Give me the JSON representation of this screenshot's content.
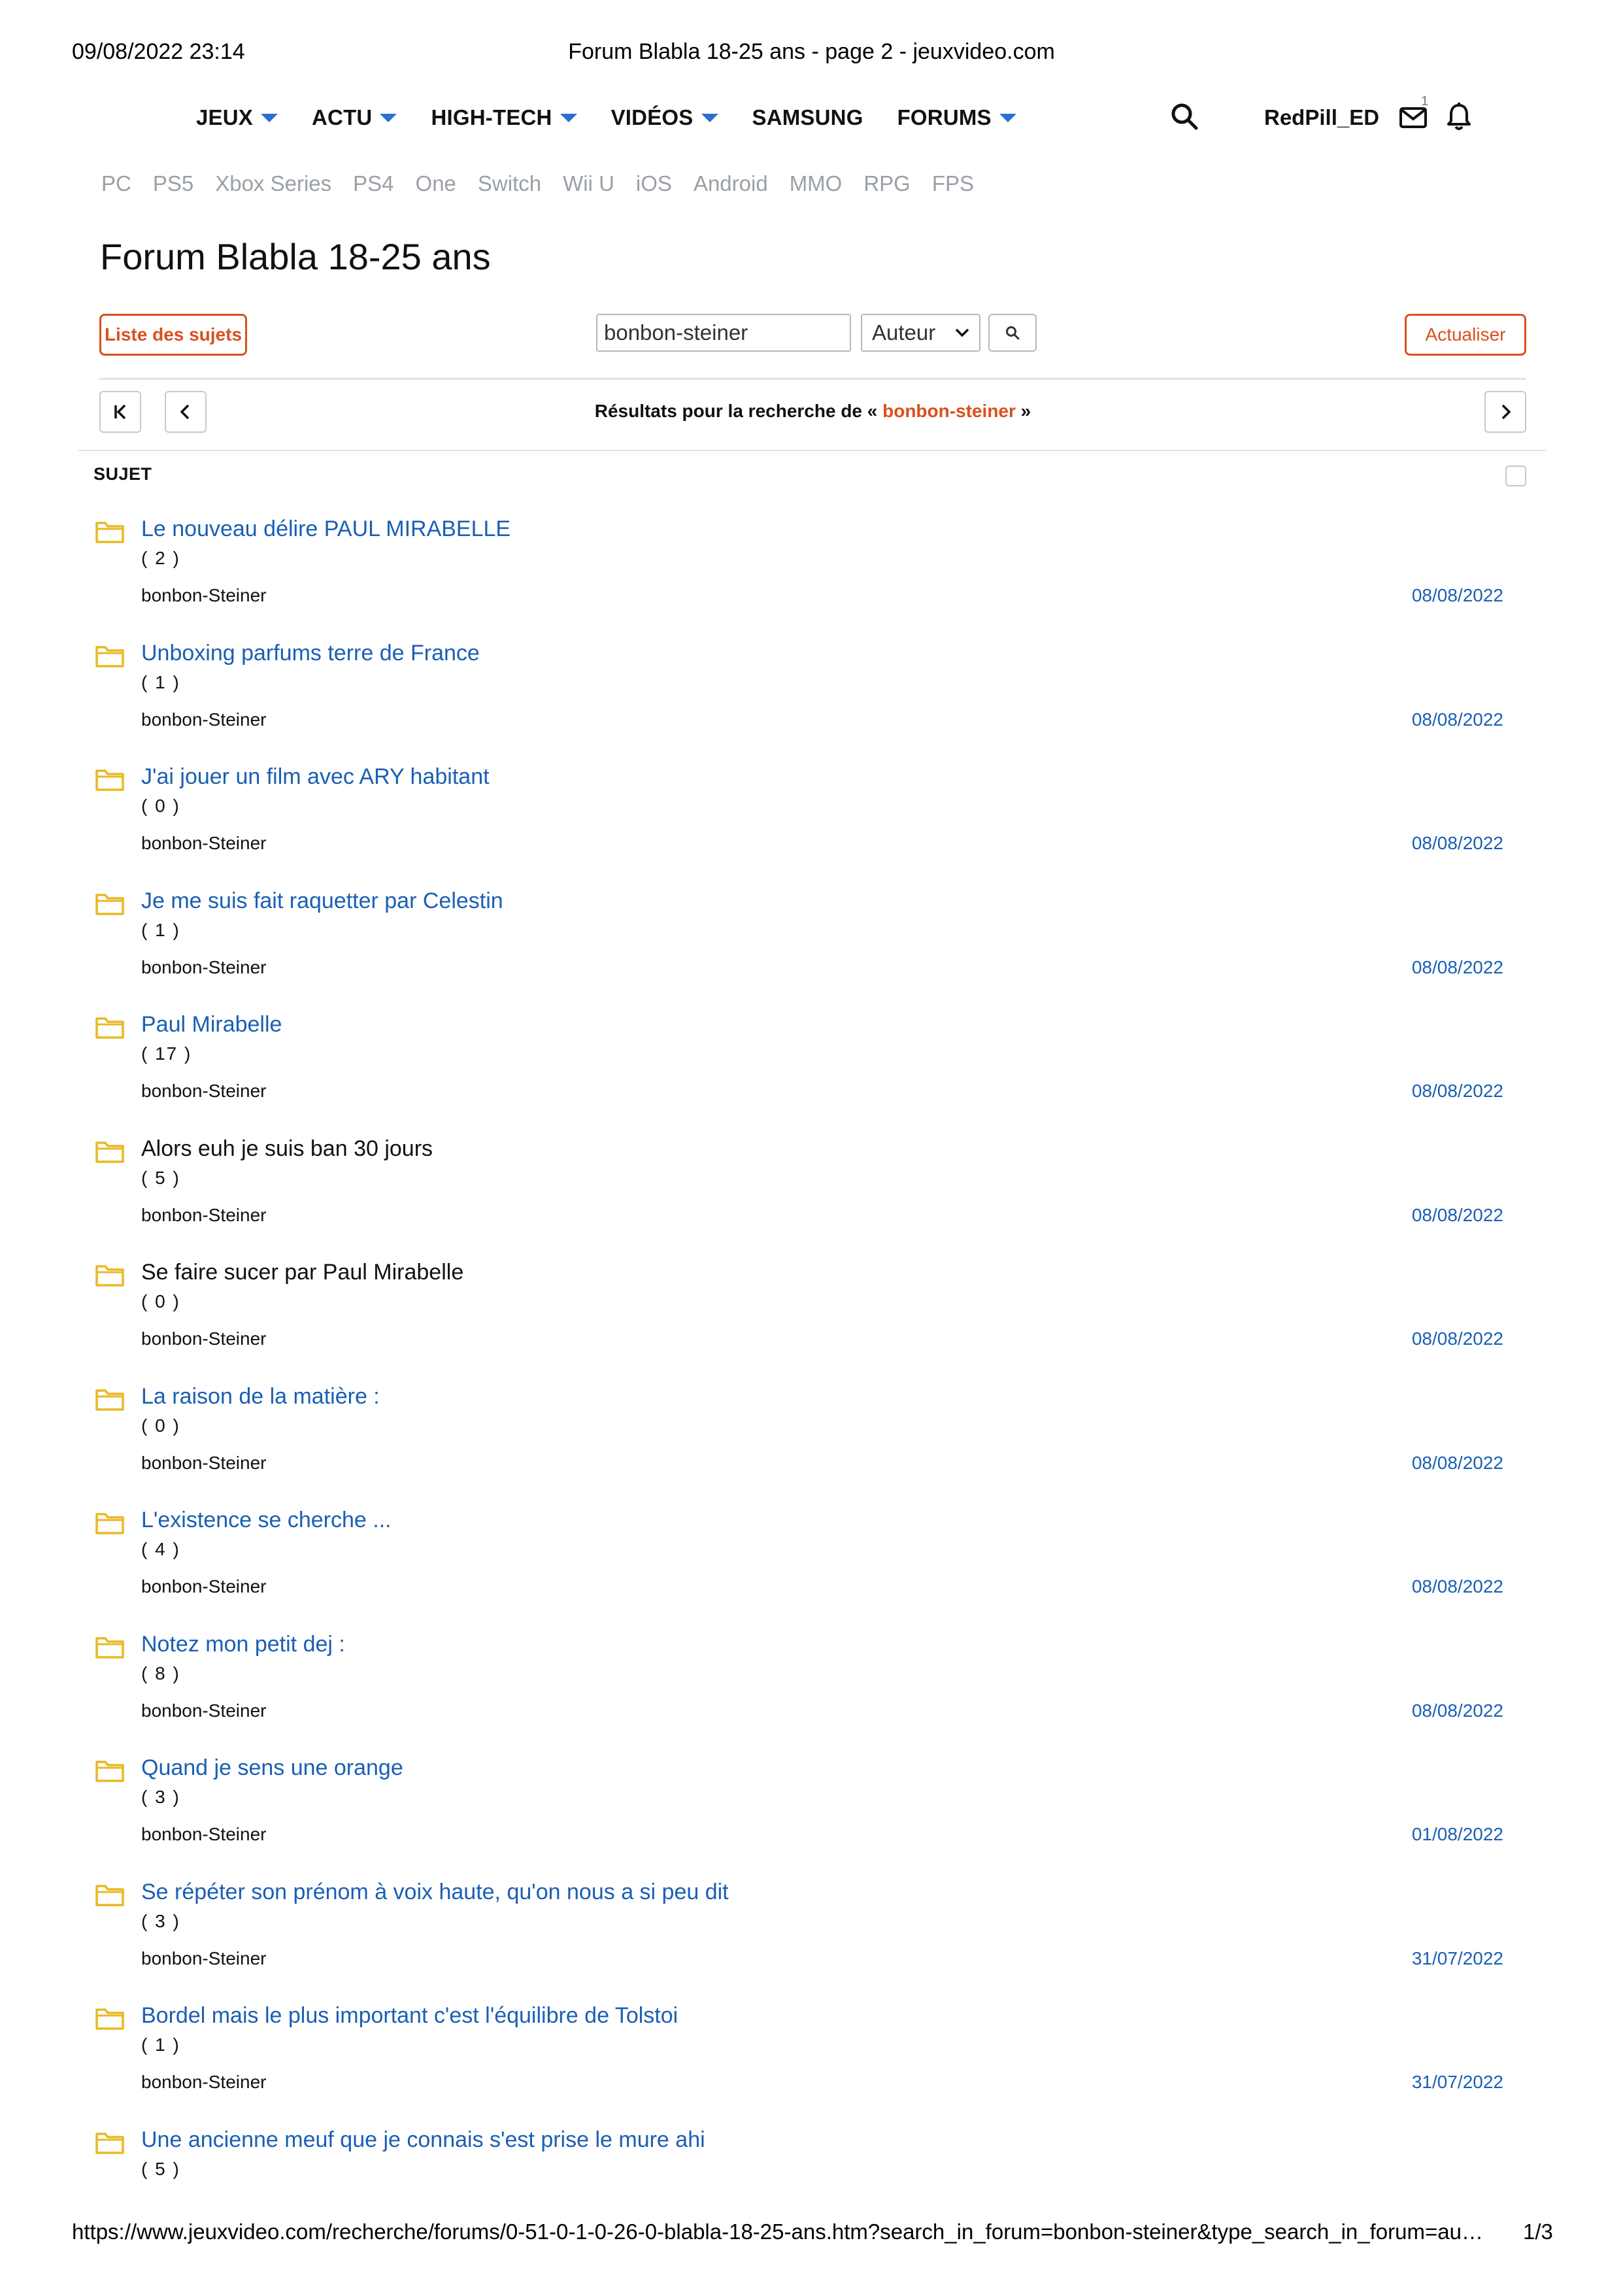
{
  "print_header": {
    "datetime": "09/08/2022 23:14",
    "page_title": "Forum Blabla 18-25 ans - page 2 - jeuxvideo.com"
  },
  "nav": {
    "items": [
      {
        "label": "JEUX",
        "dropdown": true
      },
      {
        "label": "ACTU",
        "dropdown": true
      },
      {
        "label": "HIGH-TECH",
        "dropdown": true
      },
      {
        "label": "VIDÉOS",
        "dropdown": true
      },
      {
        "label": "SAMSUNG",
        "dropdown": false
      },
      {
        "label": "FORUMS",
        "dropdown": true
      }
    ],
    "username": "RedPill_ED",
    "mail_count": "1",
    "accent_color": "#2a6fd1"
  },
  "platforms": [
    "PC",
    "PS5",
    "Xbox Series",
    "PS4",
    "One",
    "Switch",
    "Wii U",
    "iOS",
    "Android",
    "MMO",
    "RPG",
    "FPS"
  ],
  "forum_title": "Forum Blabla 18-25 ans",
  "toolbar": {
    "list_button": "Liste des sujets",
    "search_value": "bonbon-steiner",
    "search_type": "Auteur",
    "refresh_button": "Actualiser"
  },
  "results": {
    "prefix": "Résultats pour la recherche de «",
    "term": "bonbon-steiner",
    "suffix": "»"
  },
  "column_header": "SUJET",
  "topics": [
    {
      "title": "Le nouveau délire PAUL MIRABELLE",
      "count": "( 2 )",
      "author": "bonbon-Steiner",
      "date": "08/08/2022",
      "visited": false
    },
    {
      "title": "Unboxing parfums terre de France",
      "count": "( 1 )",
      "author": "bonbon-Steiner",
      "date": "08/08/2022",
      "visited": false
    },
    {
      "title": "J'ai jouer un film avec ARY habitant",
      "count": "( 0 )",
      "author": "bonbon-Steiner",
      "date": "08/08/2022",
      "visited": false
    },
    {
      "title": "Je me suis fait raquetter par Celestin",
      "count": "( 1 )",
      "author": "bonbon-Steiner",
      "date": "08/08/2022",
      "visited": false
    },
    {
      "title": "Paul Mirabelle",
      "count": "( 17 )",
      "author": "bonbon-Steiner",
      "date": "08/08/2022",
      "visited": false
    },
    {
      "title": "Alors euh je suis ban 30 jours",
      "count": "( 5 )",
      "author": "bonbon-Steiner",
      "date": "08/08/2022",
      "visited": true
    },
    {
      "title": "Se faire sucer par Paul Mirabelle",
      "count": "( 0 )",
      "author": "bonbon-Steiner",
      "date": "08/08/2022",
      "visited": true
    },
    {
      "title": "La raison de la matière :",
      "count": "( 0 )",
      "author": "bonbon-Steiner",
      "date": "08/08/2022",
      "visited": false
    },
    {
      "title": "L'existence se cherche ...",
      "count": "( 4 )",
      "author": "bonbon-Steiner",
      "date": "08/08/2022",
      "visited": false
    },
    {
      "title": "Notez mon petit dej :",
      "count": "( 8 )",
      "author": "bonbon-Steiner",
      "date": "08/08/2022",
      "visited": false
    },
    {
      "title": "Quand je sens une orange",
      "count": "( 3 )",
      "author": "bonbon-Steiner",
      "date": "01/08/2022",
      "visited": false
    },
    {
      "title": "Se répéter son prénom à voix haute, qu'on nous a si peu dit",
      "count": "( 3 )",
      "author": "bonbon-Steiner",
      "date": "31/07/2022",
      "visited": false
    },
    {
      "title": "Bordel mais le plus important c'est l'équilibre de Tolstoi",
      "count": "( 1 )",
      "author": "bonbon-Steiner",
      "date": "31/07/2022",
      "visited": false
    },
    {
      "title": "Une ancienne meuf que je connais s'est prise le mure ahi",
      "count": "( 5 )",
      "author": "",
      "date": "",
      "visited": false
    }
  ],
  "colors": {
    "link": "#1a5fb4",
    "accent_orange": "#d9501e",
    "folder": "#e8b923"
  },
  "print_footer": {
    "url": "https://www.jeuxvideo.com/recherche/forums/0-51-0-1-0-26-0-blabla-18-25-ans.htm?search_in_forum=bonbon-steiner&type_search_in_forum=au…",
    "page": "1/3"
  }
}
